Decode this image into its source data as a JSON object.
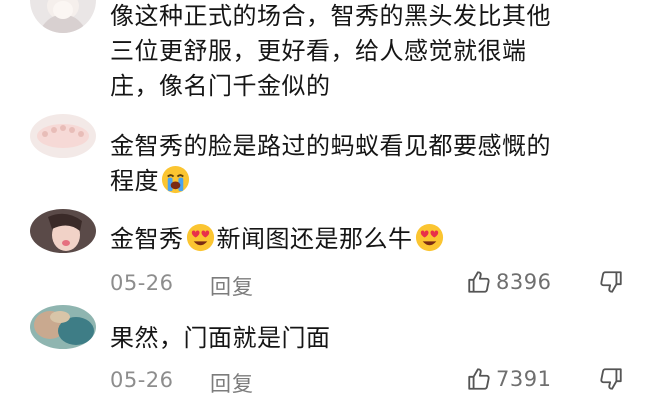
{
  "comments": [
    {
      "avatar": "avatar-girl-white",
      "text_lines": [
        "像这种正式的场合，智秀的黑头发比其他",
        "三位更舒服，更好看，给人感觉就很端",
        "庄，像名门千金似的"
      ]
    },
    {
      "avatar": "avatar-pink-lace",
      "line1": "金智秀的脸是路过的蚂蚁看见都要感慨的",
      "line2_text": "程度",
      "line2_emoji": "loudly-crying-face-icon"
    },
    {
      "avatar": "avatar-girl-tongue",
      "part1": "金智秀",
      "part2": "新闻图还是那么牛",
      "emoji": "smiling-face-with-heart-eyes-icon",
      "date": "05-26",
      "reply_label": "回复",
      "like_count": "8396"
    },
    {
      "avatar": "avatar-teal-blur",
      "text": "果然，门面就是门面",
      "date": "05-26",
      "reply_label": "回复",
      "like_count": "7391"
    }
  ],
  "colors": {
    "text": "#151515",
    "meta": "#8d8d8d",
    "icon": "#555555",
    "emoji_face": "#fbc531"
  }
}
